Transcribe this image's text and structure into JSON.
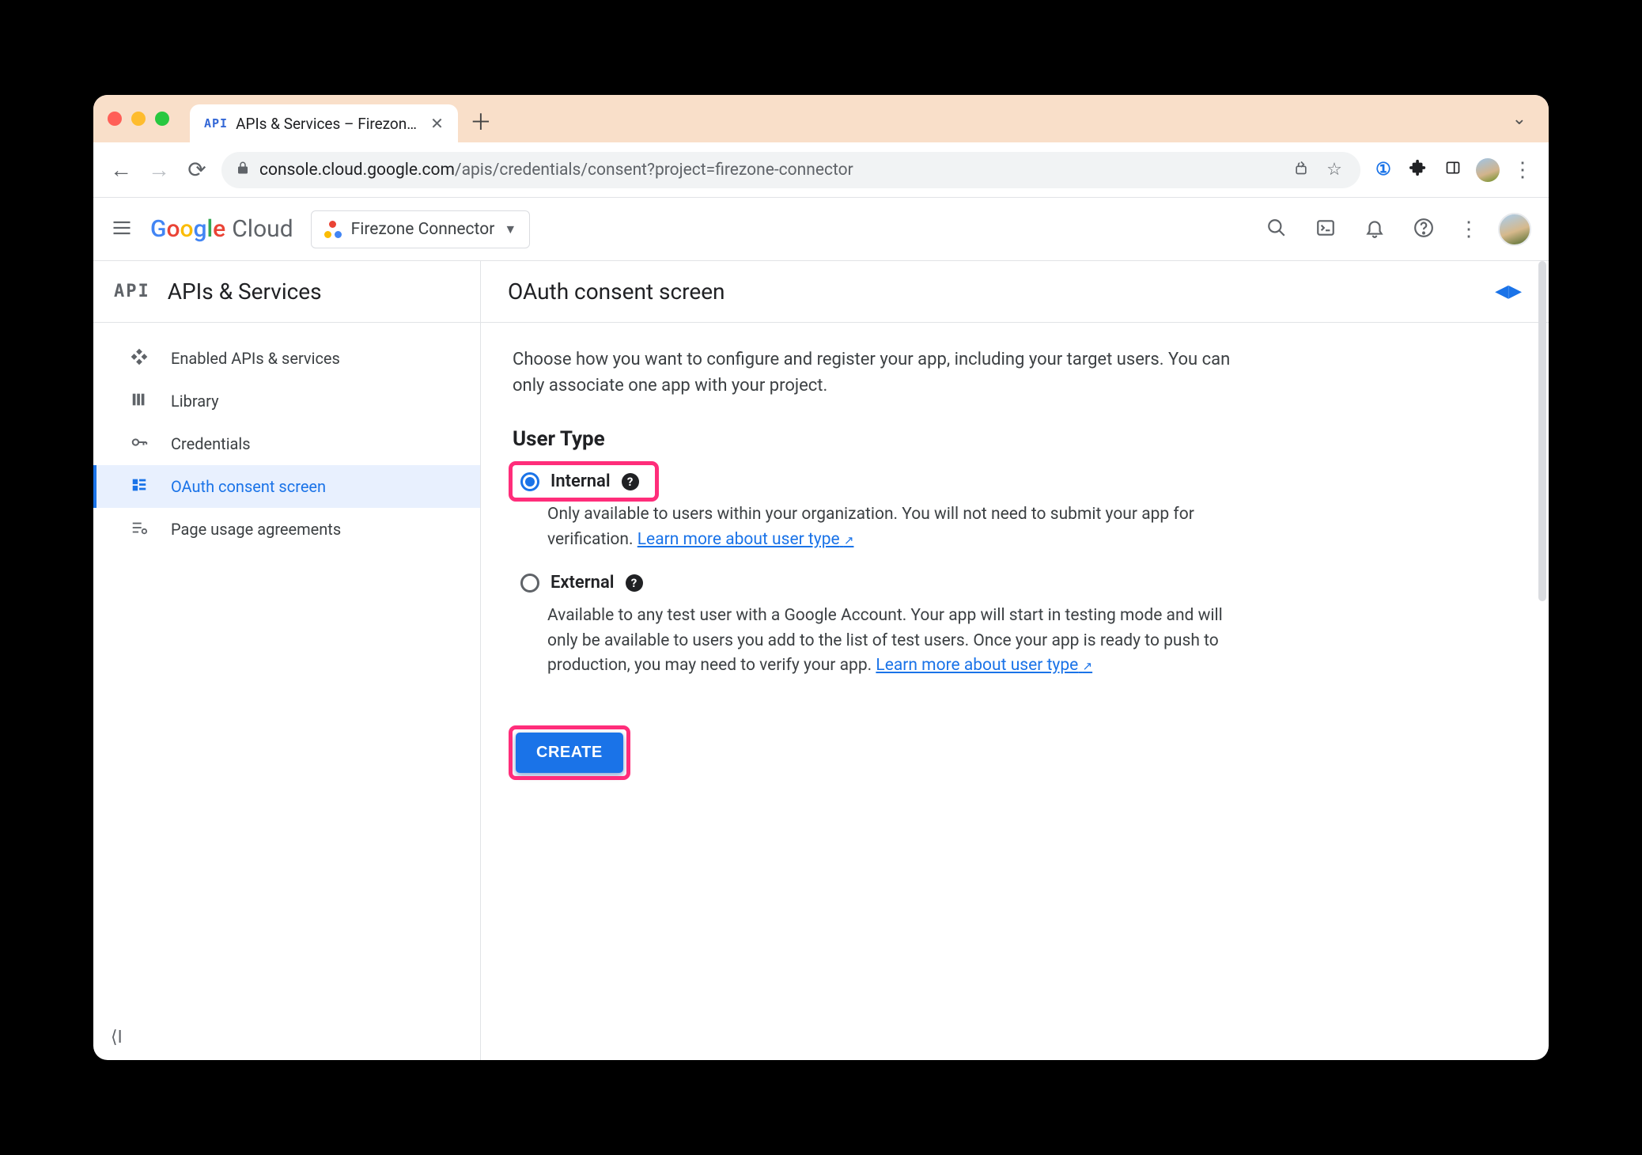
{
  "browser": {
    "tab_title": "APIs & Services – Firezone Co",
    "url_host": "console.cloud.google.com",
    "url_path": "/apis/credentials/consent?project=firezone-connector"
  },
  "header": {
    "logo_text_google": "Google",
    "logo_text_cloud": "Cloud",
    "project_label": "Firezone Connector"
  },
  "sidebar": {
    "section_title": "APIs & Services",
    "items": [
      {
        "label": "Enabled APIs & services",
        "active": false
      },
      {
        "label": "Library",
        "active": false
      },
      {
        "label": "Credentials",
        "active": false
      },
      {
        "label": "OAuth consent screen",
        "active": true
      },
      {
        "label": "Page usage agreements",
        "active": false
      }
    ]
  },
  "main": {
    "title": "OAuth consent screen",
    "intro": "Choose how you want to configure and register your app, including your target users. You can only associate one app with your project.",
    "user_type_heading": "User Type",
    "options": {
      "internal": {
        "label": "Internal",
        "desc": "Only available to users within your organization. You will not need to submit your app for verification. ",
        "link": "Learn more about user type"
      },
      "external": {
        "label": "External",
        "desc": "Available to any test user with a Google Account. Your app will start in testing mode and will only be available to users you add to the list of test users. Once your app is ready to push to production, you may need to verify your app. ",
        "link": "Learn more about user type"
      }
    },
    "create_label": "CREATE"
  }
}
